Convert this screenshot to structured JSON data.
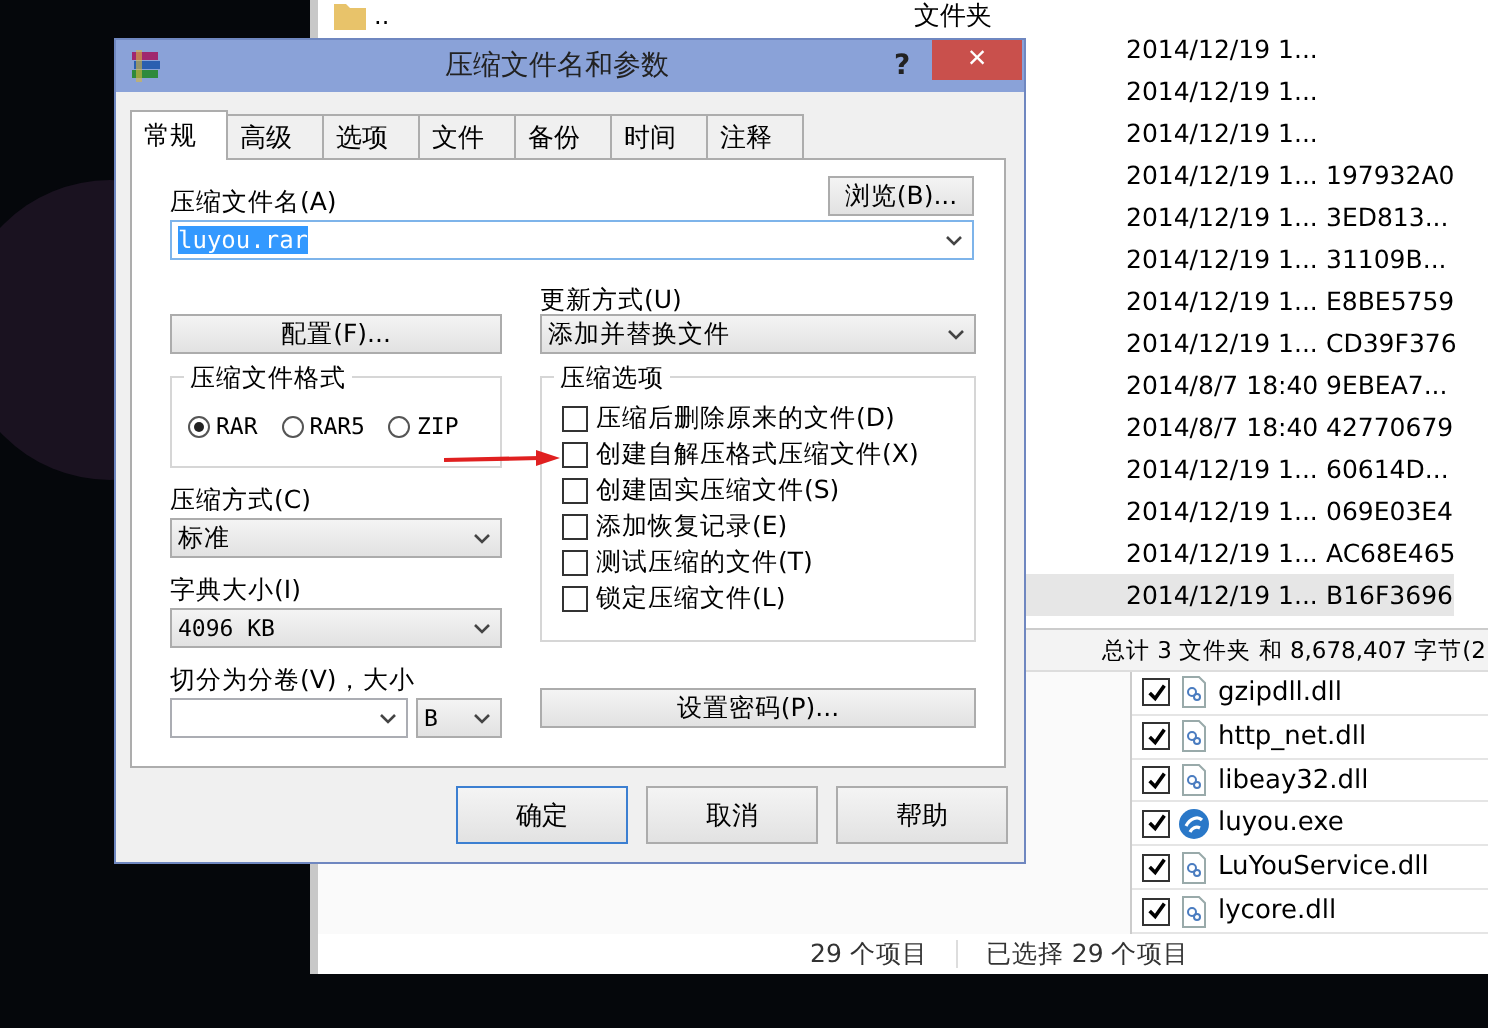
{
  "explorer": {
    "parent_row": {
      "name": "..",
      "type": "文件夹"
    },
    "rows": [
      {
        "modified": "2014/12/19 1...",
        "crc": "",
        "selected": false
      },
      {
        "modified": "2014/12/19 1...",
        "crc": "",
        "selected": false
      },
      {
        "modified": "2014/12/19 1...",
        "crc": "",
        "selected": false
      },
      {
        "modified": "2014/12/19 1...",
        "crc": "197932A0",
        "selected": false
      },
      {
        "modified": "2014/12/19 1...",
        "crc": "3ED813...",
        "selected": false
      },
      {
        "modified": "2014/12/19 1...",
        "crc": "31109B...",
        "selected": false
      },
      {
        "modified": "2014/12/19 1...",
        "crc": "E8BE5759",
        "selected": false
      },
      {
        "modified": "2014/12/19 1...",
        "crc": "CD39F376",
        "selected": false
      },
      {
        "modified": "2014/8/7 18:40",
        "crc": "9EBEA7...",
        "selected": false
      },
      {
        "modified": "2014/8/7 18:40",
        "crc": "42770679",
        "selected": false
      },
      {
        "modified": "2014/12/19 1...",
        "crc": "60614D...",
        "selected": false
      },
      {
        "modified": "2014/12/19 1...",
        "crc": "069E03E4",
        "selected": false
      },
      {
        "modified": "2014/12/19 1...",
        "crc": "AC68E465",
        "selected": false
      },
      {
        "modified": "2014/12/19 1...",
        "crc": "B16F3696",
        "selected": true
      }
    ],
    "totals": "总计 3 文件夹 和 8,678,407 字节(2",
    "files": [
      {
        "name": "gzipdll.dll",
        "kind": "dll",
        "checked": true
      },
      {
        "name": "http_net.dll",
        "kind": "dll",
        "checked": true
      },
      {
        "name": "libeay32.dll",
        "kind": "dll",
        "checked": true
      },
      {
        "name": "luyou.exe",
        "kind": "exe",
        "checked": true
      },
      {
        "name": "LuYouService.dll",
        "kind": "dll",
        "checked": true
      },
      {
        "name": "lycore.dll",
        "kind": "dll",
        "checked": true
      }
    ],
    "status_bar": {
      "count": "29 个项目",
      "selection": "已选择 29 个项目"
    }
  },
  "dialog": {
    "title": "压缩文件名和参数",
    "help": "?",
    "close": "×",
    "tabs": [
      {
        "label": "常规",
        "selected": true
      },
      {
        "label": "高级",
        "selected": false
      },
      {
        "label": "选项",
        "selected": false
      },
      {
        "label": "文件",
        "selected": false
      },
      {
        "label": "备份",
        "selected": false
      },
      {
        "label": "时间",
        "selected": false
      },
      {
        "label": "注释",
        "selected": false
      }
    ],
    "archive_name_label": "压缩文件名(A)",
    "browse_button": "浏览(B)...",
    "archive_name": "luyou.rar",
    "profiles_button": "配置(F)...",
    "update_label": "更新方式(U)",
    "update_mode": "添加并替换文件",
    "format_group": "压缩文件格式",
    "formats": [
      {
        "label": "RAR",
        "selected": true
      },
      {
        "label": "RAR5",
        "selected": false
      },
      {
        "label": "ZIP",
        "selected": false
      }
    ],
    "method_label": "压缩方式(C)",
    "method": "标准",
    "dictionary_label": "字典大小(I)",
    "dictionary": "4096 KB",
    "split_label": "切分为分卷(V)，大小",
    "split_unit": "B",
    "options_group": "压缩选项",
    "options": [
      {
        "label": "压缩后删除原来的文件(D)",
        "checked": false
      },
      {
        "label": "创建自解压格式压缩文件(X)",
        "checked": false
      },
      {
        "label": "创建固实压缩文件(S)",
        "checked": false
      },
      {
        "label": "添加恢复记录(E)",
        "checked": false
      },
      {
        "label": "测试压缩的文件(T)",
        "checked": false
      },
      {
        "label": "锁定压缩文件(L)",
        "checked": false
      }
    ],
    "password_button": "设置密码(P)...",
    "buttons": [
      "确定",
      "取消",
      "帮助"
    ]
  }
}
